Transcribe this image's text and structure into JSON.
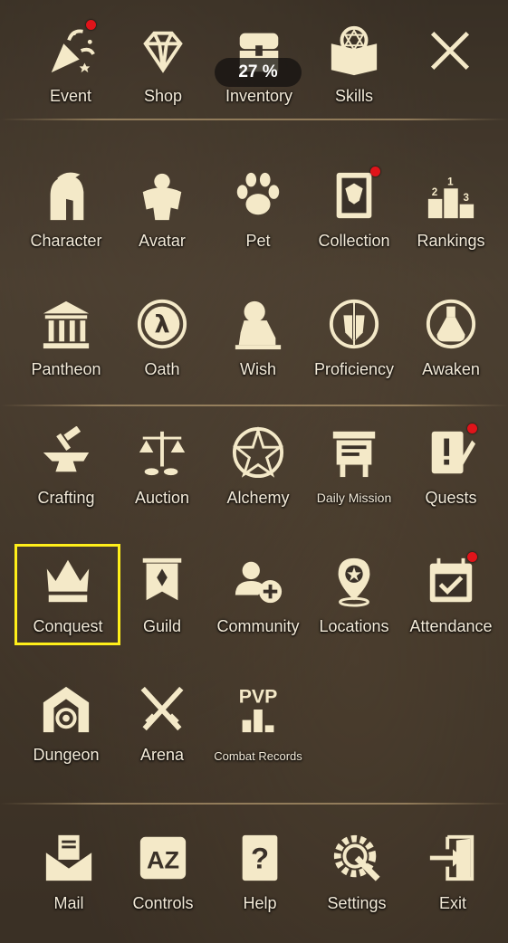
{
  "top_bar": {
    "items": [
      {
        "label": "Event",
        "icon": "party-popper-icon",
        "notification": true
      },
      {
        "label": "Shop",
        "icon": "diamond-icon",
        "notification": false
      },
      {
        "label": "Inventory",
        "icon": "chest-icon",
        "notification": false,
        "badge": "27 %"
      },
      {
        "label": "Skills",
        "icon": "spellbook-icon",
        "notification": false
      }
    ],
    "close_icon": "close-icon"
  },
  "section_1": [
    {
      "label": "Character",
      "icon": "spartan-helmet-icon",
      "notification": false
    },
    {
      "label": "Avatar",
      "icon": "armor-icon",
      "notification": false
    },
    {
      "label": "Pet",
      "icon": "paw-icon",
      "notification": false
    },
    {
      "label": "Collection",
      "icon": "card-book-icon",
      "notification": true
    },
    {
      "label": "Rankings",
      "icon": "podium-icon",
      "notification": false
    },
    {
      "label": "Pantheon",
      "icon": "temple-icon",
      "notification": false
    },
    {
      "label": "Oath",
      "icon": "lambda-icon",
      "notification": false
    },
    {
      "label": "Wish",
      "icon": "lion-statue-icon",
      "notification": false
    },
    {
      "label": "Proficiency",
      "icon": "sword-shield-icon",
      "notification": false
    },
    {
      "label": "Awaken",
      "icon": "potion-icon",
      "notification": false
    }
  ],
  "section_2": [
    {
      "label": "Crafting",
      "icon": "anvil-icon",
      "notification": false
    },
    {
      "label": "Auction",
      "icon": "scales-icon",
      "notification": false
    },
    {
      "label": "Alchemy",
      "icon": "star-circle-icon",
      "notification": false
    },
    {
      "label": "Daily Mission",
      "icon": "notice-board-icon",
      "notification": false
    },
    {
      "label": "Quests",
      "icon": "quest-scroll-icon",
      "notification": true
    },
    {
      "label": "Conquest",
      "icon": "crown-icon",
      "notification": false,
      "highlighted": true
    },
    {
      "label": "Guild",
      "icon": "banner-icon",
      "notification": false
    },
    {
      "label": "Community",
      "icon": "add-friend-icon",
      "notification": false
    },
    {
      "label": "Locations",
      "icon": "map-pin-icon",
      "notification": false
    },
    {
      "label": "Attendance",
      "icon": "calendar-check-icon",
      "notification": true
    },
    {
      "label": "Dungeon",
      "icon": "portal-icon",
      "notification": false
    },
    {
      "label": "Arena",
      "icon": "crossed-swords-icon",
      "notification": false
    },
    {
      "label": "Combat Records",
      "icon": "pvp-chart-icon",
      "notification": false,
      "icon_text": "PVP"
    }
  ],
  "bottom_bar": [
    {
      "label": "Mail",
      "icon": "envelope-icon"
    },
    {
      "label": "Controls",
      "icon": "az-keys-icon",
      "icon_text": "AZ"
    },
    {
      "label": "Help",
      "icon": "question-book-icon",
      "icon_text": "?"
    },
    {
      "label": "Settings",
      "icon": "gear-wrench-icon"
    },
    {
      "label": "Exit",
      "icon": "exit-door-icon"
    }
  ],
  "colors": {
    "highlight": "#ffef1a",
    "notification": "#e0141a",
    "icon": "#f4e9c8"
  }
}
